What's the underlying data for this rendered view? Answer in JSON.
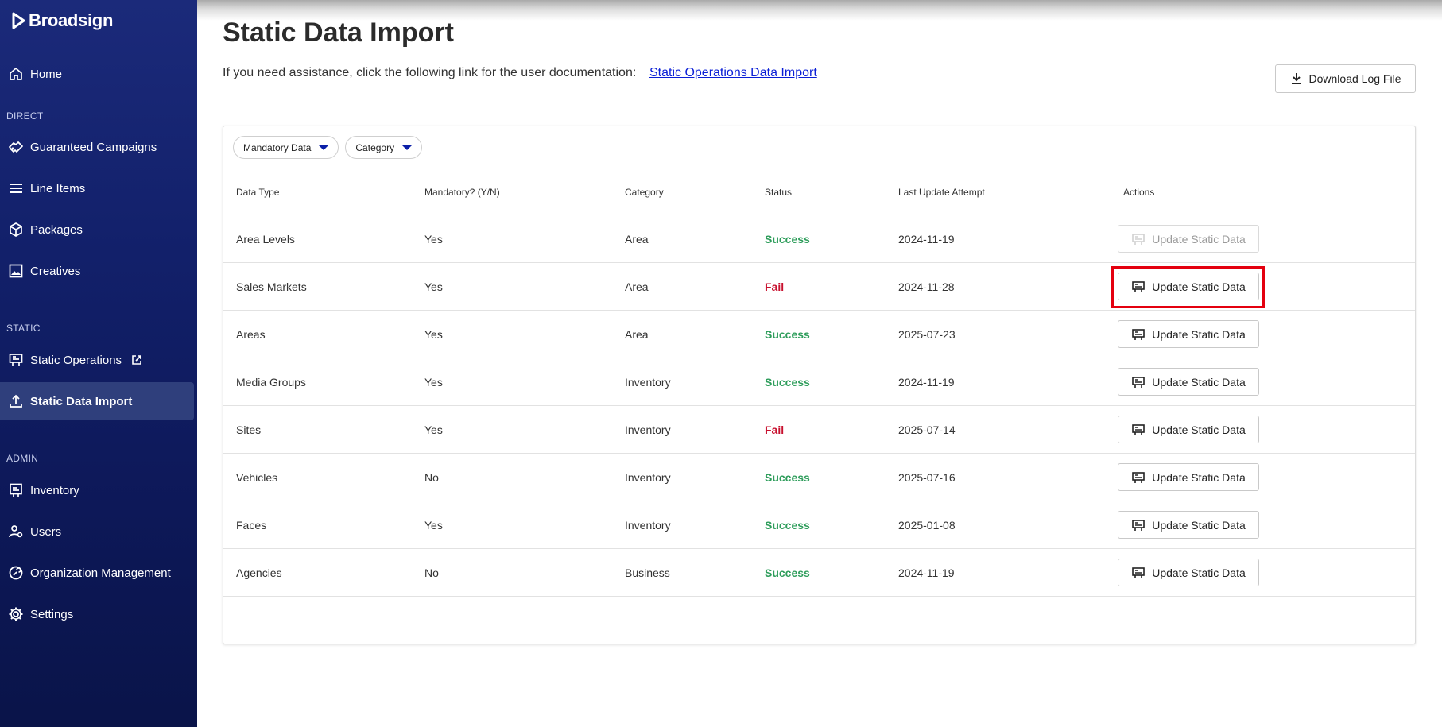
{
  "brand": {
    "name": "Broadsign"
  },
  "sidebar": {
    "sections": {
      "direct": "DIRECT",
      "static": "STATIC",
      "admin": "ADMIN"
    },
    "items": [
      {
        "label": "Home",
        "icon": "home-icon"
      },
      {
        "label": "Guaranteed Campaigns",
        "icon": "handshake-icon"
      },
      {
        "label": "Line Items",
        "icon": "list-icon"
      },
      {
        "label": "Packages",
        "icon": "package-icon"
      },
      {
        "label": "Creatives",
        "icon": "image-icon"
      },
      {
        "label": "Static Operations",
        "icon": "billboard-icon"
      },
      {
        "label": "Static Data Import",
        "icon": "upload-icon",
        "active": true
      },
      {
        "label": "Inventory",
        "icon": "screen-icon"
      },
      {
        "label": "Users",
        "icon": "users-icon"
      },
      {
        "label": "Organization Management",
        "icon": "org-icon"
      },
      {
        "label": "Settings",
        "icon": "gear-icon"
      }
    ]
  },
  "main": {
    "title": "Static Data Import",
    "help_text": "If you need assistance, click the following link for the user documentation:",
    "help_link": "Static Operations Data Import",
    "download_label": "Download Log File"
  },
  "filters": {
    "mandatory": "Mandatory Data",
    "category": "Category"
  },
  "table": {
    "headers": [
      "Data Type",
      "Mandatory? (Y/N)",
      "Category",
      "Status",
      "Last Update Attempt",
      "Actions"
    ],
    "action_label": "Update Static Data",
    "rows": [
      {
        "data_type": "Area Levels",
        "mandatory": "Yes",
        "category": "Area",
        "status": "Success",
        "date": "2024-11-19"
      },
      {
        "data_type": "Sales Markets",
        "mandatory": "Yes",
        "category": "Area",
        "status": "Fail",
        "date": "2024-11-28"
      },
      {
        "data_type": "Areas",
        "mandatory": "Yes",
        "category": "Area",
        "status": "Success",
        "date": "2025-07-23"
      },
      {
        "data_type": "Media Groups",
        "mandatory": "Yes",
        "category": "Inventory",
        "status": "Success",
        "date": "2024-11-19"
      },
      {
        "data_type": "Sites",
        "mandatory": "Yes",
        "category": "Inventory",
        "status": "Fail",
        "date": "2025-07-14"
      },
      {
        "data_type": "Vehicles",
        "mandatory": "No",
        "category": "Inventory",
        "status": "Success",
        "date": "2025-07-16"
      },
      {
        "data_type": "Faces",
        "mandatory": "Yes",
        "category": "Inventory",
        "status": "Success",
        "date": "2025-01-08"
      },
      {
        "data_type": "Agencies",
        "mandatory": "No",
        "category": "Business",
        "status": "Success",
        "date": "2024-11-19"
      }
    ]
  },
  "colors": {
    "success": "#2e9d5b",
    "fail": "#c8102e",
    "link": "#0b1fd6",
    "sidebar": "#12206a",
    "highlight": "#e4000f"
  }
}
